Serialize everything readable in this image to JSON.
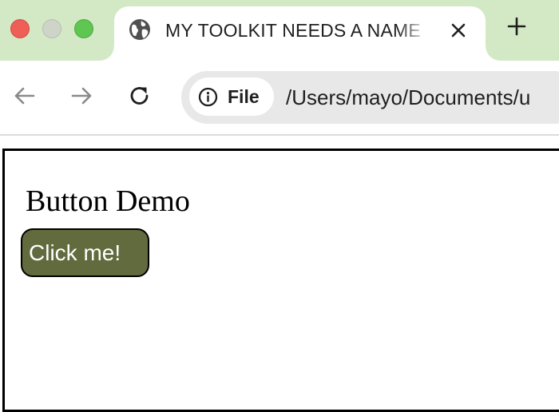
{
  "window": {
    "controls": [
      "close",
      "minimize",
      "maximize"
    ]
  },
  "tab": {
    "title": "MY TOOLKIT NEEDS A NAME",
    "icon": "globe-icon",
    "close_icon": "close-icon"
  },
  "new_tab_icon": "plus-icon",
  "toolbar": {
    "back_icon": "arrow-left-icon",
    "forward_icon": "arrow-right-icon",
    "reload_icon": "reload-icon"
  },
  "address_bar": {
    "chip_icon": "info-icon",
    "chip_label": "File",
    "url": "/Users/mayo/Documents/u"
  },
  "page": {
    "heading": "Button Demo",
    "button_label": "Click me!"
  },
  "colors": {
    "tab_strip": "#d3e9c5",
    "button_bg": "#626b3e",
    "button_text": "#ffffff"
  }
}
